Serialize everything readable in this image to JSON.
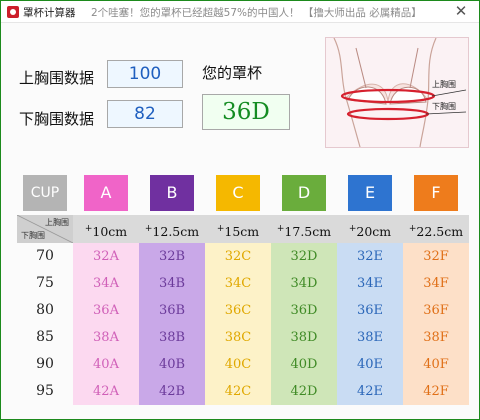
{
  "window": {
    "app_title": "罩杯计算器",
    "message": "2个哇塞！您的罩杯已经超越57%的中国人！ 【撸大师出品 必属精品】",
    "close_glyph": "✕"
  },
  "form": {
    "upper_label": "上胸围数据",
    "upper_value": "100",
    "lower_label": "下胸围数据",
    "lower_value": "82",
    "result_label": "您的罩杯",
    "result_value": "36D"
  },
  "illustration": {
    "upper_text": "上胸围",
    "lower_text": "下胸围"
  },
  "table": {
    "corner_upper": "上胸围",
    "corner_lower": "下胸围",
    "cup_header": "CUP",
    "cups": [
      {
        "letter": "A",
        "color": "#f064c8",
        "bg": "#fcd9f0",
        "text": "#d060b8",
        "inc": "10cm"
      },
      {
        "letter": "B",
        "color": "#7030a0",
        "bg": "#c9a8e8",
        "text": "#6b3a9a",
        "inc": "12.5cm"
      },
      {
        "letter": "C",
        "color": "#f5b800",
        "bg": "#fdf2c8",
        "text": "#e0a800",
        "inc": "15cm"
      },
      {
        "letter": "D",
        "color": "#6aad3c",
        "bg": "#cfe6b8",
        "text": "#3f8a25",
        "inc": "17.5cm"
      },
      {
        "letter": "E",
        "color": "#2e74d0",
        "bg": "#c9dcf3",
        "text": "#2a66b8",
        "inc": "20cm"
      },
      {
        "letter": "F",
        "color": "#ee7c1c",
        "bg": "#fde0c8",
        "text": "#e07018",
        "inc": "22.5cm"
      }
    ],
    "plus": "+",
    "under_values": [
      "70",
      "75",
      "80",
      "85",
      "90",
      "95"
    ],
    "rows": [
      [
        "32A",
        "32B",
        "32C",
        "32D",
        "32E",
        "32F"
      ],
      [
        "34A",
        "34B",
        "34C",
        "34D",
        "34E",
        "34F"
      ],
      [
        "36A",
        "36B",
        "36C",
        "36D",
        "36E",
        "36F"
      ],
      [
        "38A",
        "38B",
        "38C",
        "38D",
        "38E",
        "38F"
      ],
      [
        "40A",
        "40B",
        "40C",
        "40D",
        "40E",
        "40F"
      ],
      [
        "42A",
        "42B",
        "42C",
        "42D",
        "42E",
        "42F"
      ]
    ]
  }
}
